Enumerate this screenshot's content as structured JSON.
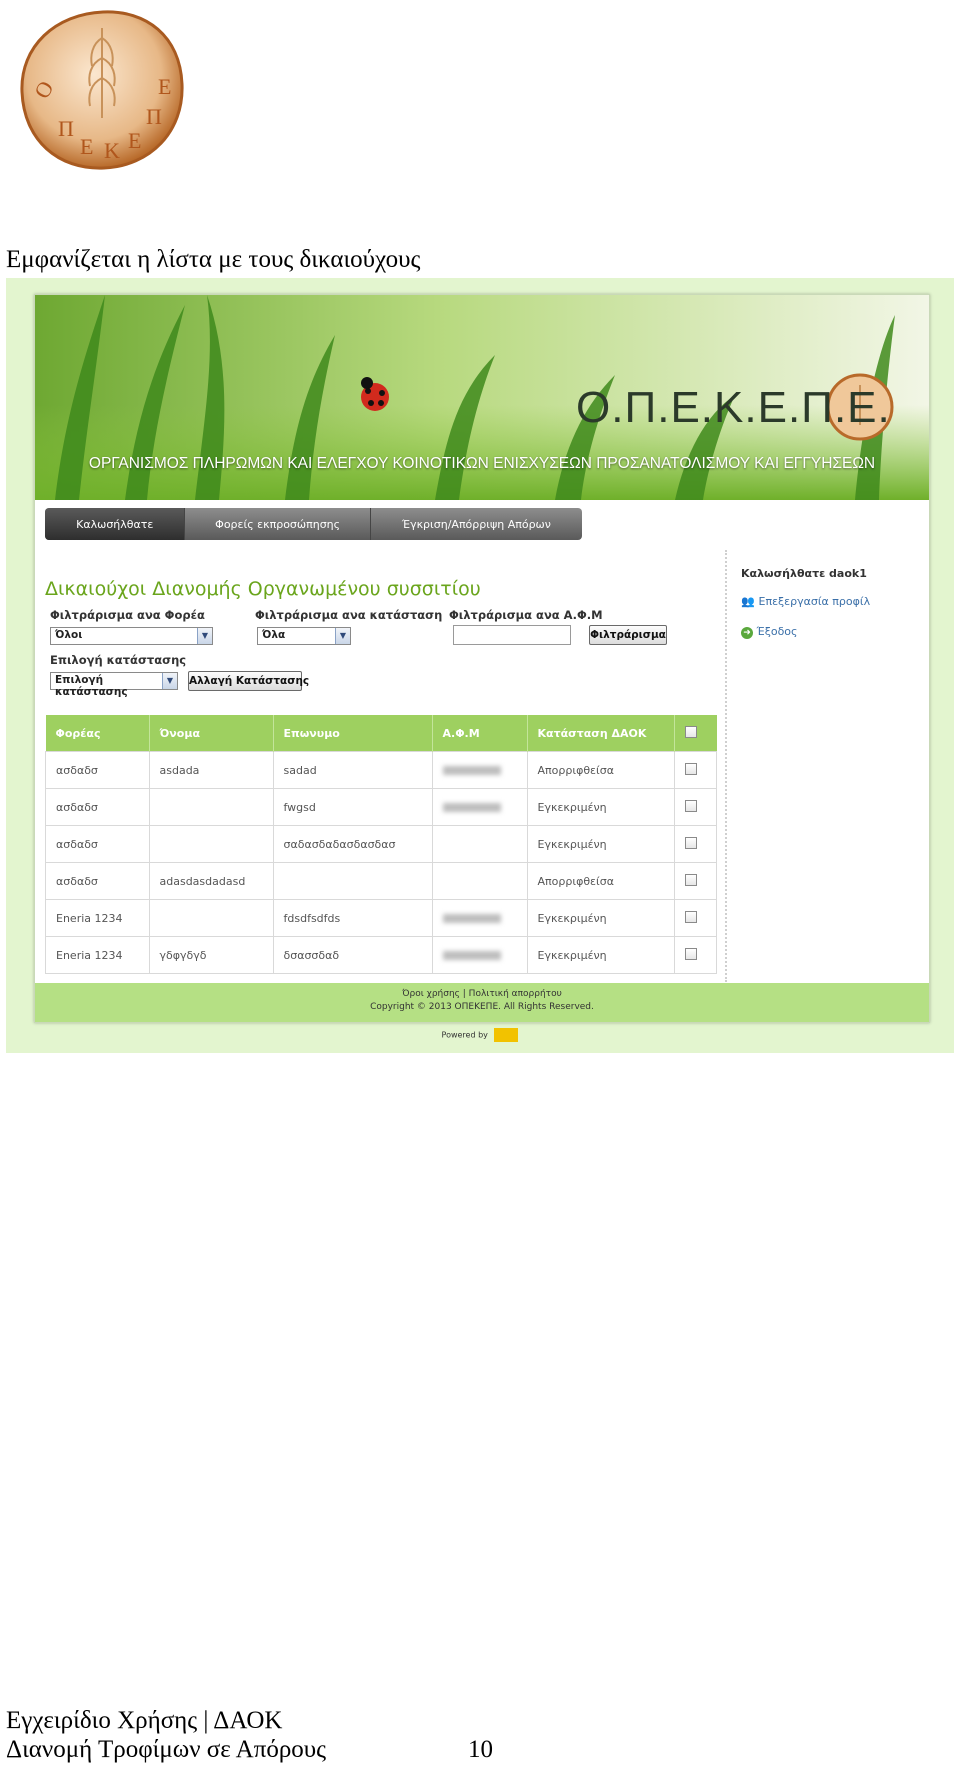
{
  "logo": {
    "text": "ΟΠΕΚΕΠΕ"
  },
  "doc_heading": "Εμφανίζεται η λίστα με τους δικαιούχους",
  "app": {
    "banner_title": "Ο.Π.Ε.Κ.Ε.Π.Ε.",
    "banner_subtitle": "ΟΡΓΑΝΙΣΜΟΣ ΠΛΗΡΩΜΩΝ ΚΑΙ ΕΛΕΓΧΟΥ ΚΟΙΝΟΤΙΚΩΝ ΕΝΙΣΧΥΣΕΩΝ ΠΡΟΣΑΝΑΤΟΛΙΣΜΟΥ ΚΑΙ ΕΓΓΥΗΣΕΩΝ",
    "nav": [
      "Καλωσήλθατε",
      "Φορείς εκπροσώπησης",
      "Έγκριση/Απόρριψη Απόρων"
    ],
    "page_title": "Δικαιούχοι Διανομής Οργανωμένου συσσιτίου",
    "filters": {
      "by_body_label": "Φιλτράρισμα ανα Φορέα",
      "by_body_value": "Όλοι",
      "by_status_label": "Φιλτράρισμα ανα κατάσταση",
      "by_status_value": "Όλα",
      "by_afm_label": "Φιλτράρισμα ανα Α.Φ.Μ",
      "filter_button": "Φιλτράρισμα"
    },
    "status_select": {
      "label": "Επιλογή κατάστασης",
      "value": "Επιλογή κατάστασης",
      "button": "Αλλαγή Κατάστασης"
    },
    "table": {
      "headers": [
        "Φορέας",
        "Όνομα",
        "Επωνυμο",
        "Α.Φ.Μ",
        "Κατάσταση ΔΑΟΚ"
      ],
      "rows": [
        {
          "body": "ασδαδσ",
          "first": "asdada",
          "last": "sadad",
          "status": "Απορριφθείσα"
        },
        {
          "body": "ασδαδσ",
          "first": "",
          "last": "fwgsd",
          "status": "Εγκεκριμένη"
        },
        {
          "body": "ασδαδσ",
          "first": "",
          "last": "σαδασδαδασδασδασ",
          "status": "Εγκεκριμένη"
        },
        {
          "body": "ασδαδσ",
          "first": "adasdasdadasd",
          "last": "",
          "status": "Απορριφθείσα"
        },
        {
          "body": "Eneria 1234",
          "first": "",
          "last": "fdsdfsdfds",
          "status": "Εγκεκριμένη"
        },
        {
          "body": "Eneria 1234",
          "first": "γδφγδγδ",
          "last": "δσασσδαδ",
          "status": "Εγκεκριμένη"
        }
      ]
    },
    "sidebar": {
      "welcome": "Καλωσήλθατε daok1",
      "edit_profile": "Επεξεργασία προφίλ",
      "logout": "Έξοδος"
    },
    "footer": {
      "links": "Όροι χρήσης | Πολιτική απορρήτου",
      "copyright": "Copyright © 2013 ΟΠΕΚΕΠΕ. All Rights Reserved.",
      "powered": "Powered by"
    }
  },
  "doc_footer": {
    "line1": "Εγχειρίδιο Χρήσης | ΔΑΟΚ",
    "line2": "Διανομή Τροφίμων σε Απόρους",
    "page": "10"
  }
}
